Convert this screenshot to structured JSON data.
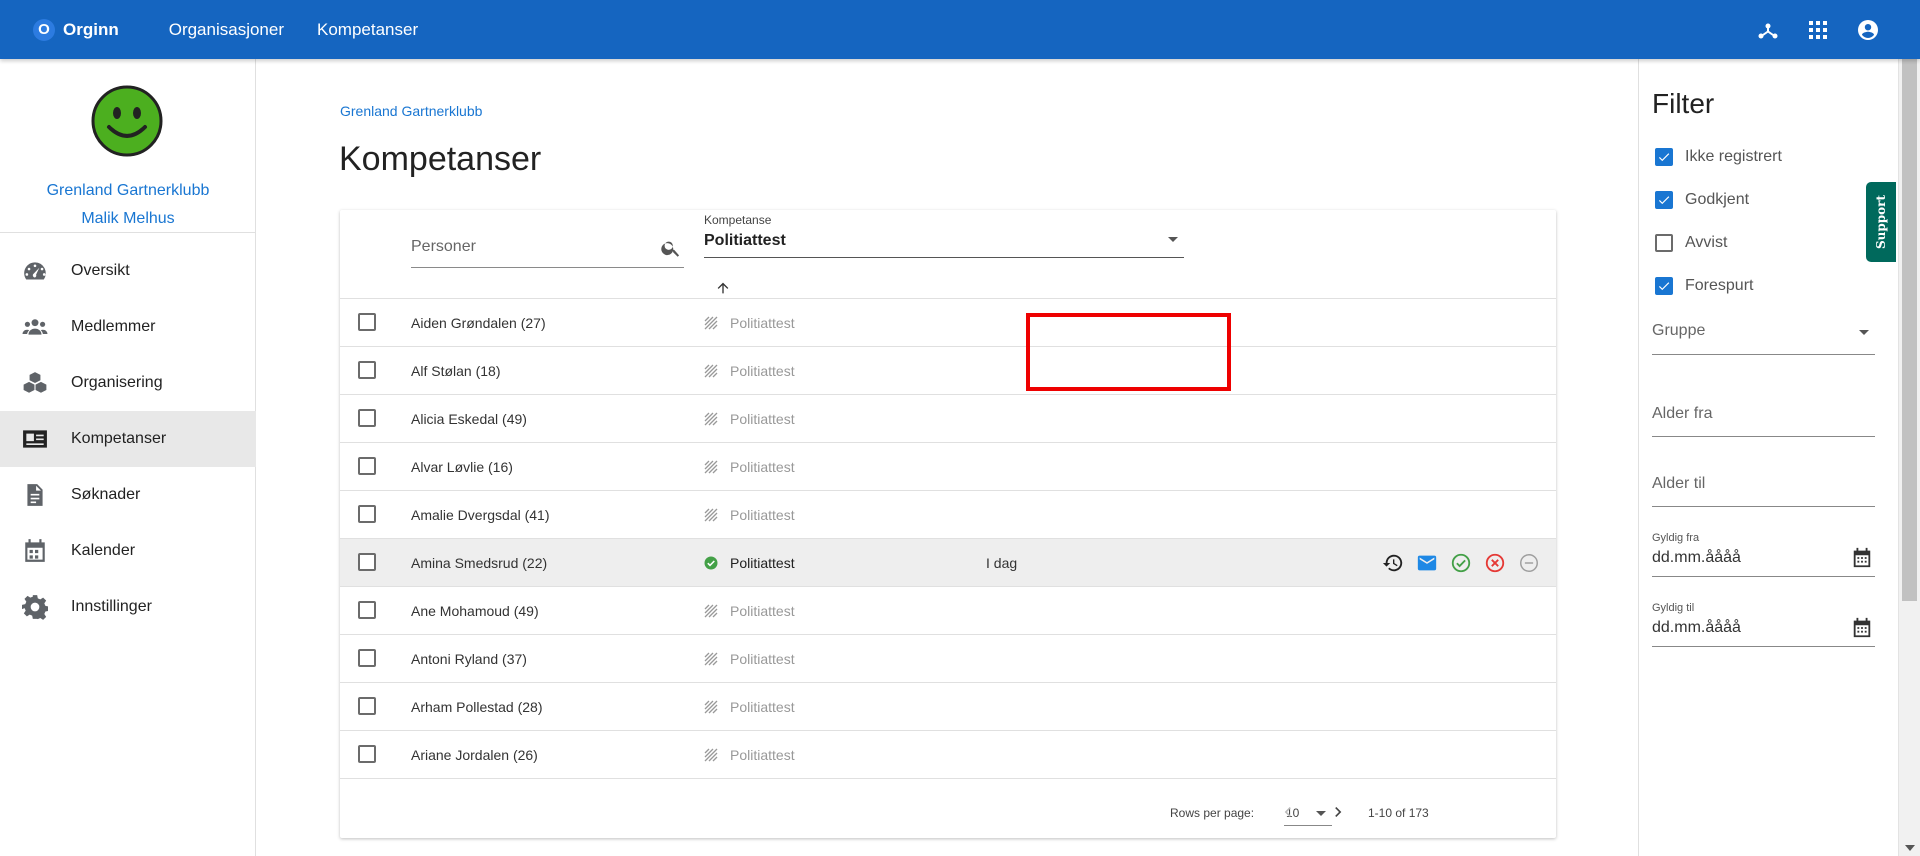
{
  "topbar": {
    "logo_letter": "O",
    "app_name": "Orginn",
    "nav": [
      "Organisasjoner",
      "Kompetanser"
    ],
    "icons": [
      "hub-icon",
      "apps-icon",
      "account-icon"
    ]
  },
  "sidebar": {
    "club": "Grenland Gartnerklubb",
    "user": "Malik Melhus",
    "items": [
      {
        "label": "Oversikt",
        "icon": "dashboard-icon"
      },
      {
        "label": "Medlemmer",
        "icon": "people-icon"
      },
      {
        "label": "Organisering",
        "icon": "cubes-icon"
      },
      {
        "label": "Kompetanser",
        "icon": "id-card-icon",
        "active": true
      },
      {
        "label": "Søknader",
        "icon": "document-icon"
      },
      {
        "label": "Kalender",
        "icon": "calendar-icon"
      },
      {
        "label": "Innstillinger",
        "icon": "gear-icon"
      }
    ]
  },
  "main": {
    "breadcrumb": "Grenland Gartnerklubb",
    "title": "Kompetanser",
    "search_placeholder": "Personer",
    "kompetanse_label": "Kompetanse",
    "kompetanse_value": "Politiattest",
    "rows": [
      {
        "name": "Aiden Grøndalen (27)",
        "komp": "Politiattest",
        "status": "pending",
        "when": ""
      },
      {
        "name": "Alf Stølan (18)",
        "komp": "Politiattest",
        "status": "pending",
        "when": ""
      },
      {
        "name": "Alicia Eskedal (49)",
        "komp": "Politiattest",
        "status": "pending",
        "when": ""
      },
      {
        "name": "Alvar Løvlie (16)",
        "komp": "Politiattest",
        "status": "pending",
        "when": ""
      },
      {
        "name": "Amalie Dvergsdal (41)",
        "komp": "Politiattest",
        "status": "pending",
        "when": ""
      },
      {
        "name": "Amina Smedsrud (22)",
        "komp": "Politiattest",
        "status": "approved",
        "when": "I dag"
      },
      {
        "name": "Ane Mohamoud (49)",
        "komp": "Politiattest",
        "status": "pending",
        "when": ""
      },
      {
        "name": "Antoni Ryland (37)",
        "komp": "Politiattest",
        "status": "pending",
        "when": ""
      },
      {
        "name": "Arham Pollestad (28)",
        "komp": "Politiattest",
        "status": "pending",
        "when": ""
      },
      {
        "name": "Ariane Jordalen (26)",
        "komp": "Politiattest",
        "status": "pending",
        "when": ""
      }
    ],
    "row_actions": [
      "history-icon",
      "mail-icon",
      "approve-icon",
      "reject-icon",
      "remove-icon"
    ],
    "pager": {
      "rows_per_page_label": "Rows per page:",
      "rows_per_page": "10",
      "range": "1-10 of 173"
    }
  },
  "filter": {
    "title": "Filter",
    "checks": [
      {
        "label": "Ikke registrert",
        "checked": true
      },
      {
        "label": "Godkjent",
        "checked": true
      },
      {
        "label": "Avvist",
        "checked": false
      },
      {
        "label": "Forespurt",
        "checked": true
      }
    ],
    "gruppe": "Gruppe",
    "alder_fra": "Alder fra",
    "alder_til": "Alder til",
    "gyldig_fra_label": "Gyldig fra",
    "gyldig_fra_value": "dd.mm.åååå",
    "gyldig_til_label": "Gyldig til",
    "gyldig_til_value": "dd.mm.åååå"
  },
  "support_label": "Support",
  "colors": {
    "topbar": "#1565c0",
    "link": "#1976d2",
    "approved": "#43a047",
    "reject": "#e53935",
    "highlight": "#ff0000",
    "support": "#00695c"
  }
}
